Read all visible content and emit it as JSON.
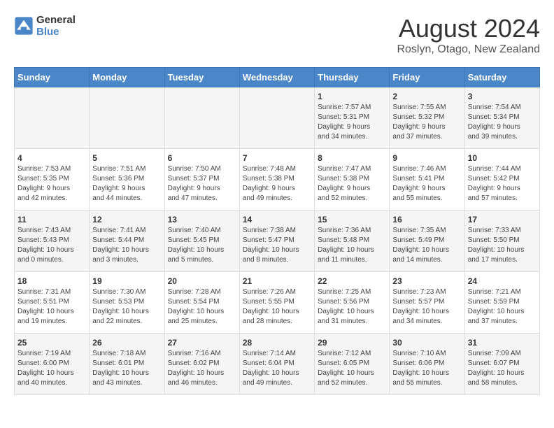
{
  "header": {
    "logo_line1": "General",
    "logo_line2": "Blue",
    "main_title": "August 2024",
    "subtitle": "Roslyn, Otago, New Zealand"
  },
  "days_of_week": [
    "Sunday",
    "Monday",
    "Tuesday",
    "Wednesday",
    "Thursday",
    "Friday",
    "Saturday"
  ],
  "weeks": [
    [
      {
        "day": "",
        "info": ""
      },
      {
        "day": "",
        "info": ""
      },
      {
        "day": "",
        "info": ""
      },
      {
        "day": "",
        "info": ""
      },
      {
        "day": "1",
        "info": "Sunrise: 7:57 AM\nSunset: 5:31 PM\nDaylight: 9 hours\nand 34 minutes."
      },
      {
        "day": "2",
        "info": "Sunrise: 7:55 AM\nSunset: 5:32 PM\nDaylight: 9 hours\nand 37 minutes."
      },
      {
        "day": "3",
        "info": "Sunrise: 7:54 AM\nSunset: 5:34 PM\nDaylight: 9 hours\nand 39 minutes."
      }
    ],
    [
      {
        "day": "4",
        "info": "Sunrise: 7:53 AM\nSunset: 5:35 PM\nDaylight: 9 hours\nand 42 minutes."
      },
      {
        "day": "5",
        "info": "Sunrise: 7:51 AM\nSunset: 5:36 PM\nDaylight: 9 hours\nand 44 minutes."
      },
      {
        "day": "6",
        "info": "Sunrise: 7:50 AM\nSunset: 5:37 PM\nDaylight: 9 hours\nand 47 minutes."
      },
      {
        "day": "7",
        "info": "Sunrise: 7:48 AM\nSunset: 5:38 PM\nDaylight: 9 hours\nand 49 minutes."
      },
      {
        "day": "8",
        "info": "Sunrise: 7:47 AM\nSunset: 5:38 PM\nDaylight: 9 hours\nand 52 minutes."
      },
      {
        "day": "9",
        "info": "Sunrise: 7:46 AM\nSunset: 5:41 PM\nDaylight: 9 hours\nand 55 minutes."
      },
      {
        "day": "10",
        "info": "Sunrise: 7:44 AM\nSunset: 5:42 PM\nDaylight: 9 hours\nand 57 minutes."
      }
    ],
    [
      {
        "day": "11",
        "info": "Sunrise: 7:43 AM\nSunset: 5:43 PM\nDaylight: 10 hours\nand 0 minutes."
      },
      {
        "day": "12",
        "info": "Sunrise: 7:41 AM\nSunset: 5:44 PM\nDaylight: 10 hours\nand 3 minutes."
      },
      {
        "day": "13",
        "info": "Sunrise: 7:40 AM\nSunset: 5:45 PM\nDaylight: 10 hours\nand 5 minutes."
      },
      {
        "day": "14",
        "info": "Sunrise: 7:38 AM\nSunset: 5:47 PM\nDaylight: 10 hours\nand 8 minutes."
      },
      {
        "day": "15",
        "info": "Sunrise: 7:36 AM\nSunset: 5:48 PM\nDaylight: 10 hours\nand 11 minutes."
      },
      {
        "day": "16",
        "info": "Sunrise: 7:35 AM\nSunset: 5:49 PM\nDaylight: 10 hours\nand 14 minutes."
      },
      {
        "day": "17",
        "info": "Sunrise: 7:33 AM\nSunset: 5:50 PM\nDaylight: 10 hours\nand 17 minutes."
      }
    ],
    [
      {
        "day": "18",
        "info": "Sunrise: 7:31 AM\nSunset: 5:51 PM\nDaylight: 10 hours\nand 19 minutes."
      },
      {
        "day": "19",
        "info": "Sunrise: 7:30 AM\nSunset: 5:53 PM\nDaylight: 10 hours\nand 22 minutes."
      },
      {
        "day": "20",
        "info": "Sunrise: 7:28 AM\nSunset: 5:54 PM\nDaylight: 10 hours\nand 25 minutes."
      },
      {
        "day": "21",
        "info": "Sunrise: 7:26 AM\nSunset: 5:55 PM\nDaylight: 10 hours\nand 28 minutes."
      },
      {
        "day": "22",
        "info": "Sunrise: 7:25 AM\nSunset: 5:56 PM\nDaylight: 10 hours\nand 31 minutes."
      },
      {
        "day": "23",
        "info": "Sunrise: 7:23 AM\nSunset: 5:57 PM\nDaylight: 10 hours\nand 34 minutes."
      },
      {
        "day": "24",
        "info": "Sunrise: 7:21 AM\nSunset: 5:59 PM\nDaylight: 10 hours\nand 37 minutes."
      }
    ],
    [
      {
        "day": "25",
        "info": "Sunrise: 7:19 AM\nSunset: 6:00 PM\nDaylight: 10 hours\nand 40 minutes."
      },
      {
        "day": "26",
        "info": "Sunrise: 7:18 AM\nSunset: 6:01 PM\nDaylight: 10 hours\nand 43 minutes."
      },
      {
        "day": "27",
        "info": "Sunrise: 7:16 AM\nSunset: 6:02 PM\nDaylight: 10 hours\nand 46 minutes."
      },
      {
        "day": "28",
        "info": "Sunrise: 7:14 AM\nSunset: 6:04 PM\nDaylight: 10 hours\nand 49 minutes."
      },
      {
        "day": "29",
        "info": "Sunrise: 7:12 AM\nSunset: 6:05 PM\nDaylight: 10 hours\nand 52 minutes."
      },
      {
        "day": "30",
        "info": "Sunrise: 7:10 AM\nSunset: 6:06 PM\nDaylight: 10 hours\nand 55 minutes."
      },
      {
        "day": "31",
        "info": "Sunrise: 7:09 AM\nSunset: 6:07 PM\nDaylight: 10 hours\nand 58 minutes."
      }
    ]
  ]
}
